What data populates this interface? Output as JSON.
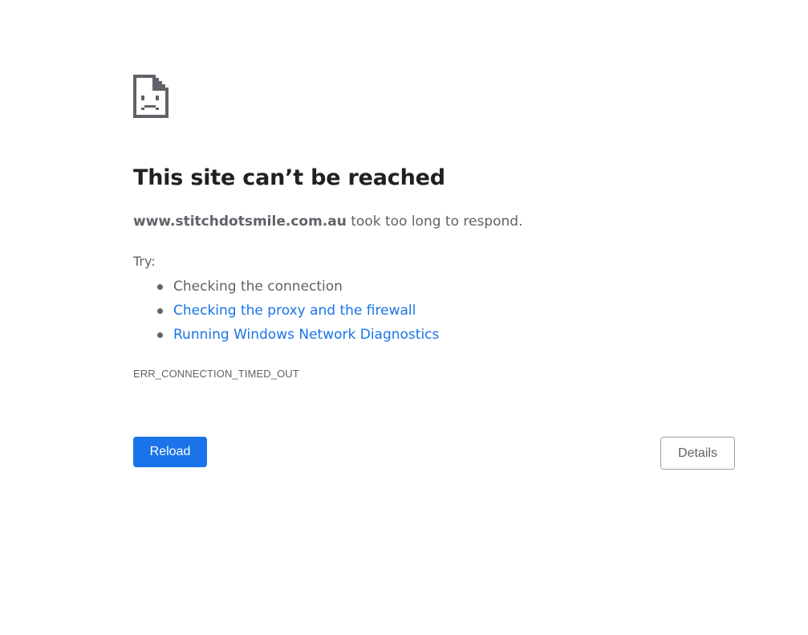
{
  "error_icon": "sad-page-icon",
  "headline": "This site can’t be reached",
  "summary": {
    "host": "www.stitchdotsmile.com.au",
    "message": " took too long to respond."
  },
  "try_label": "Try:",
  "suggestions": [
    {
      "label": "Checking the connection",
      "link": false
    },
    {
      "label": "Checking the proxy and the firewall",
      "link": true
    },
    {
      "label": "Running Windows Network Diagnostics",
      "link": true
    }
  ],
  "error_code": "ERR_CONNECTION_TIMED_OUT",
  "buttons": {
    "reload": "Reload",
    "details": "Details"
  },
  "colors": {
    "accent": "#1a73e8",
    "text": "#5f6368",
    "heading": "#202124"
  }
}
